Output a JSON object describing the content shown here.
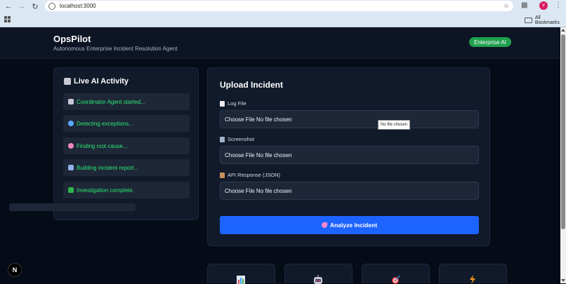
{
  "browser": {
    "url": "localhost:3000",
    "profile_initial": "Y",
    "bookmarks_label": "All Bookmarks"
  },
  "header": {
    "title": "OpsPilot",
    "subtitle": "Autonomous Enterprise Incident Resolution Agent",
    "badge": "Enterprise AI"
  },
  "live_activity": {
    "title": "Live AI Activity",
    "items": [
      {
        "icon": "robot-icon",
        "label": "Coordinator Agent started..."
      },
      {
        "icon": "magnifier-icon",
        "label": "Detecting exceptions..."
      },
      {
        "icon": "brain-icon",
        "label": "Finding root cause..."
      },
      {
        "icon": "chart-icon",
        "label": "Building incident report..."
      },
      {
        "icon": "check-icon",
        "label": "Investigation complete."
      }
    ]
  },
  "upload": {
    "title": "Upload Incident",
    "fields": [
      {
        "icon": "document-icon",
        "label": "Log File",
        "value": "Choose File No file chosen"
      },
      {
        "icon": "image-icon",
        "label": "Screenshot",
        "value": "Choose File No file chosen"
      },
      {
        "icon": "package-icon",
        "label": "API Response (JSON)",
        "value": "Choose File No file chosen"
      }
    ],
    "tooltip": "No file chosen",
    "analyze_label": "Analyze Incident"
  },
  "feature_cards": [
    {
      "icon": "bar-chart-icon"
    },
    {
      "icon": "robot-icon"
    },
    {
      "icon": "target-icon"
    },
    {
      "icon": "lightning-icon"
    }
  ],
  "next_badge": "N",
  "colors": {
    "background": "#060b18",
    "panel": "#111a2a",
    "accent_green": "#2ee86d",
    "button_blue": "#1d63ff",
    "badge_green": "#1fa14e"
  }
}
